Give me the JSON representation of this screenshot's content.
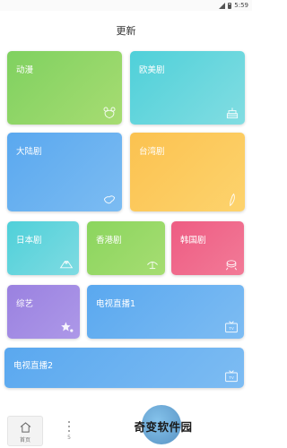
{
  "status_bar": {
    "time": "5:59"
  },
  "header": {
    "title": "更新"
  },
  "categories": {
    "anime": "动漫",
    "western": "欧美剧",
    "mainland": "大陆剧",
    "taiwan": "台湾剧",
    "japan": "日本剧",
    "hongkong": "香港剧",
    "korea": "韩国剧",
    "variety": "综艺",
    "tv_live_1": "电视直播1",
    "tv_live_2": "电视直播2"
  },
  "bottom_nav": {
    "home_label": "首页",
    "more_count": "5"
  },
  "watermark": {
    "text": "奇变软件园"
  },
  "icons": {
    "anime": "bear-icon",
    "western": "cake-icon",
    "mainland": "map-mainland-icon",
    "taiwan": "map-taiwan-icon",
    "japan": "mount-fuji-icon",
    "hongkong": "bauhinia-icon",
    "korea": "drum-icon",
    "variety": "stars-icon",
    "tv": "tv-icon",
    "home": "home-icon"
  }
}
